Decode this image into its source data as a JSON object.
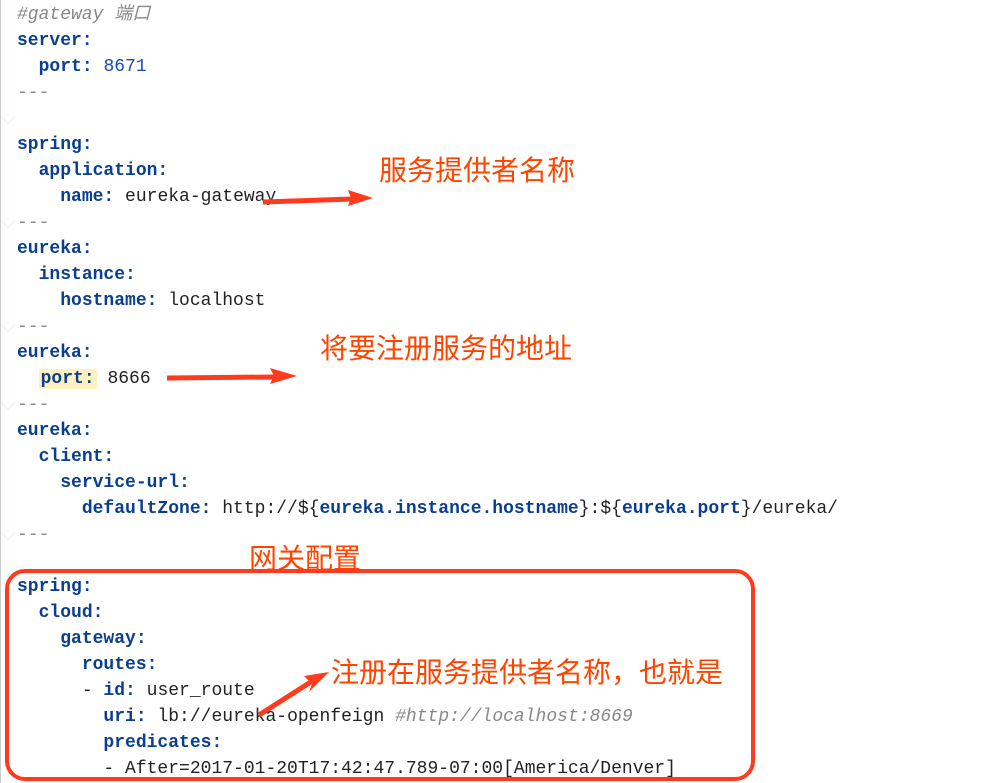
{
  "code": {
    "line1_comment": "#gateway 端口",
    "line2_key": "server:",
    "line3_key": "port:",
    "line3_val": "8671",
    "sep": "---",
    "line5_key": "spring:",
    "line6_key": "application:",
    "line7_key": "name:",
    "line7_val": "eureka-gateway",
    "line9_key": "eureka:",
    "line10_key": "instance:",
    "line11_key": "hostname:",
    "line11_val": "localhost",
    "line13_key": "eureka:",
    "line14_key": "port:",
    "line14_val": "8666",
    "line16_key": "eureka:",
    "line17_key": "client:",
    "line18_key": "service-url:",
    "line19_key": "defaultZone:",
    "line19_url1": "http://${",
    "line19_var1": "eureka.instance.hostname",
    "line19_url2": "}:${",
    "line19_var2": "eureka.port",
    "line19_url3": "}/eureka/",
    "line21_key": "spring:",
    "line22_key": "cloud:",
    "line23_key": "gateway:",
    "line24_key": "routes:",
    "line25_dash": "- ",
    "line25_key": "id:",
    "line25_val": "user_route",
    "line26_key": "uri:",
    "line26_val": "lb://eureka-openfeign",
    "line26_comment": "#http://localhost:8669",
    "line27_key": "predicates:",
    "line28_val": "- After=2017-01-20T17:42:47.789-07:00[America/Denver]"
  },
  "annotations": {
    "a1": "服务提供者名称",
    "a2": "将要注册服务的地址",
    "a3": "网关配置",
    "a4": "注册在服务提供者名称，也就是"
  }
}
